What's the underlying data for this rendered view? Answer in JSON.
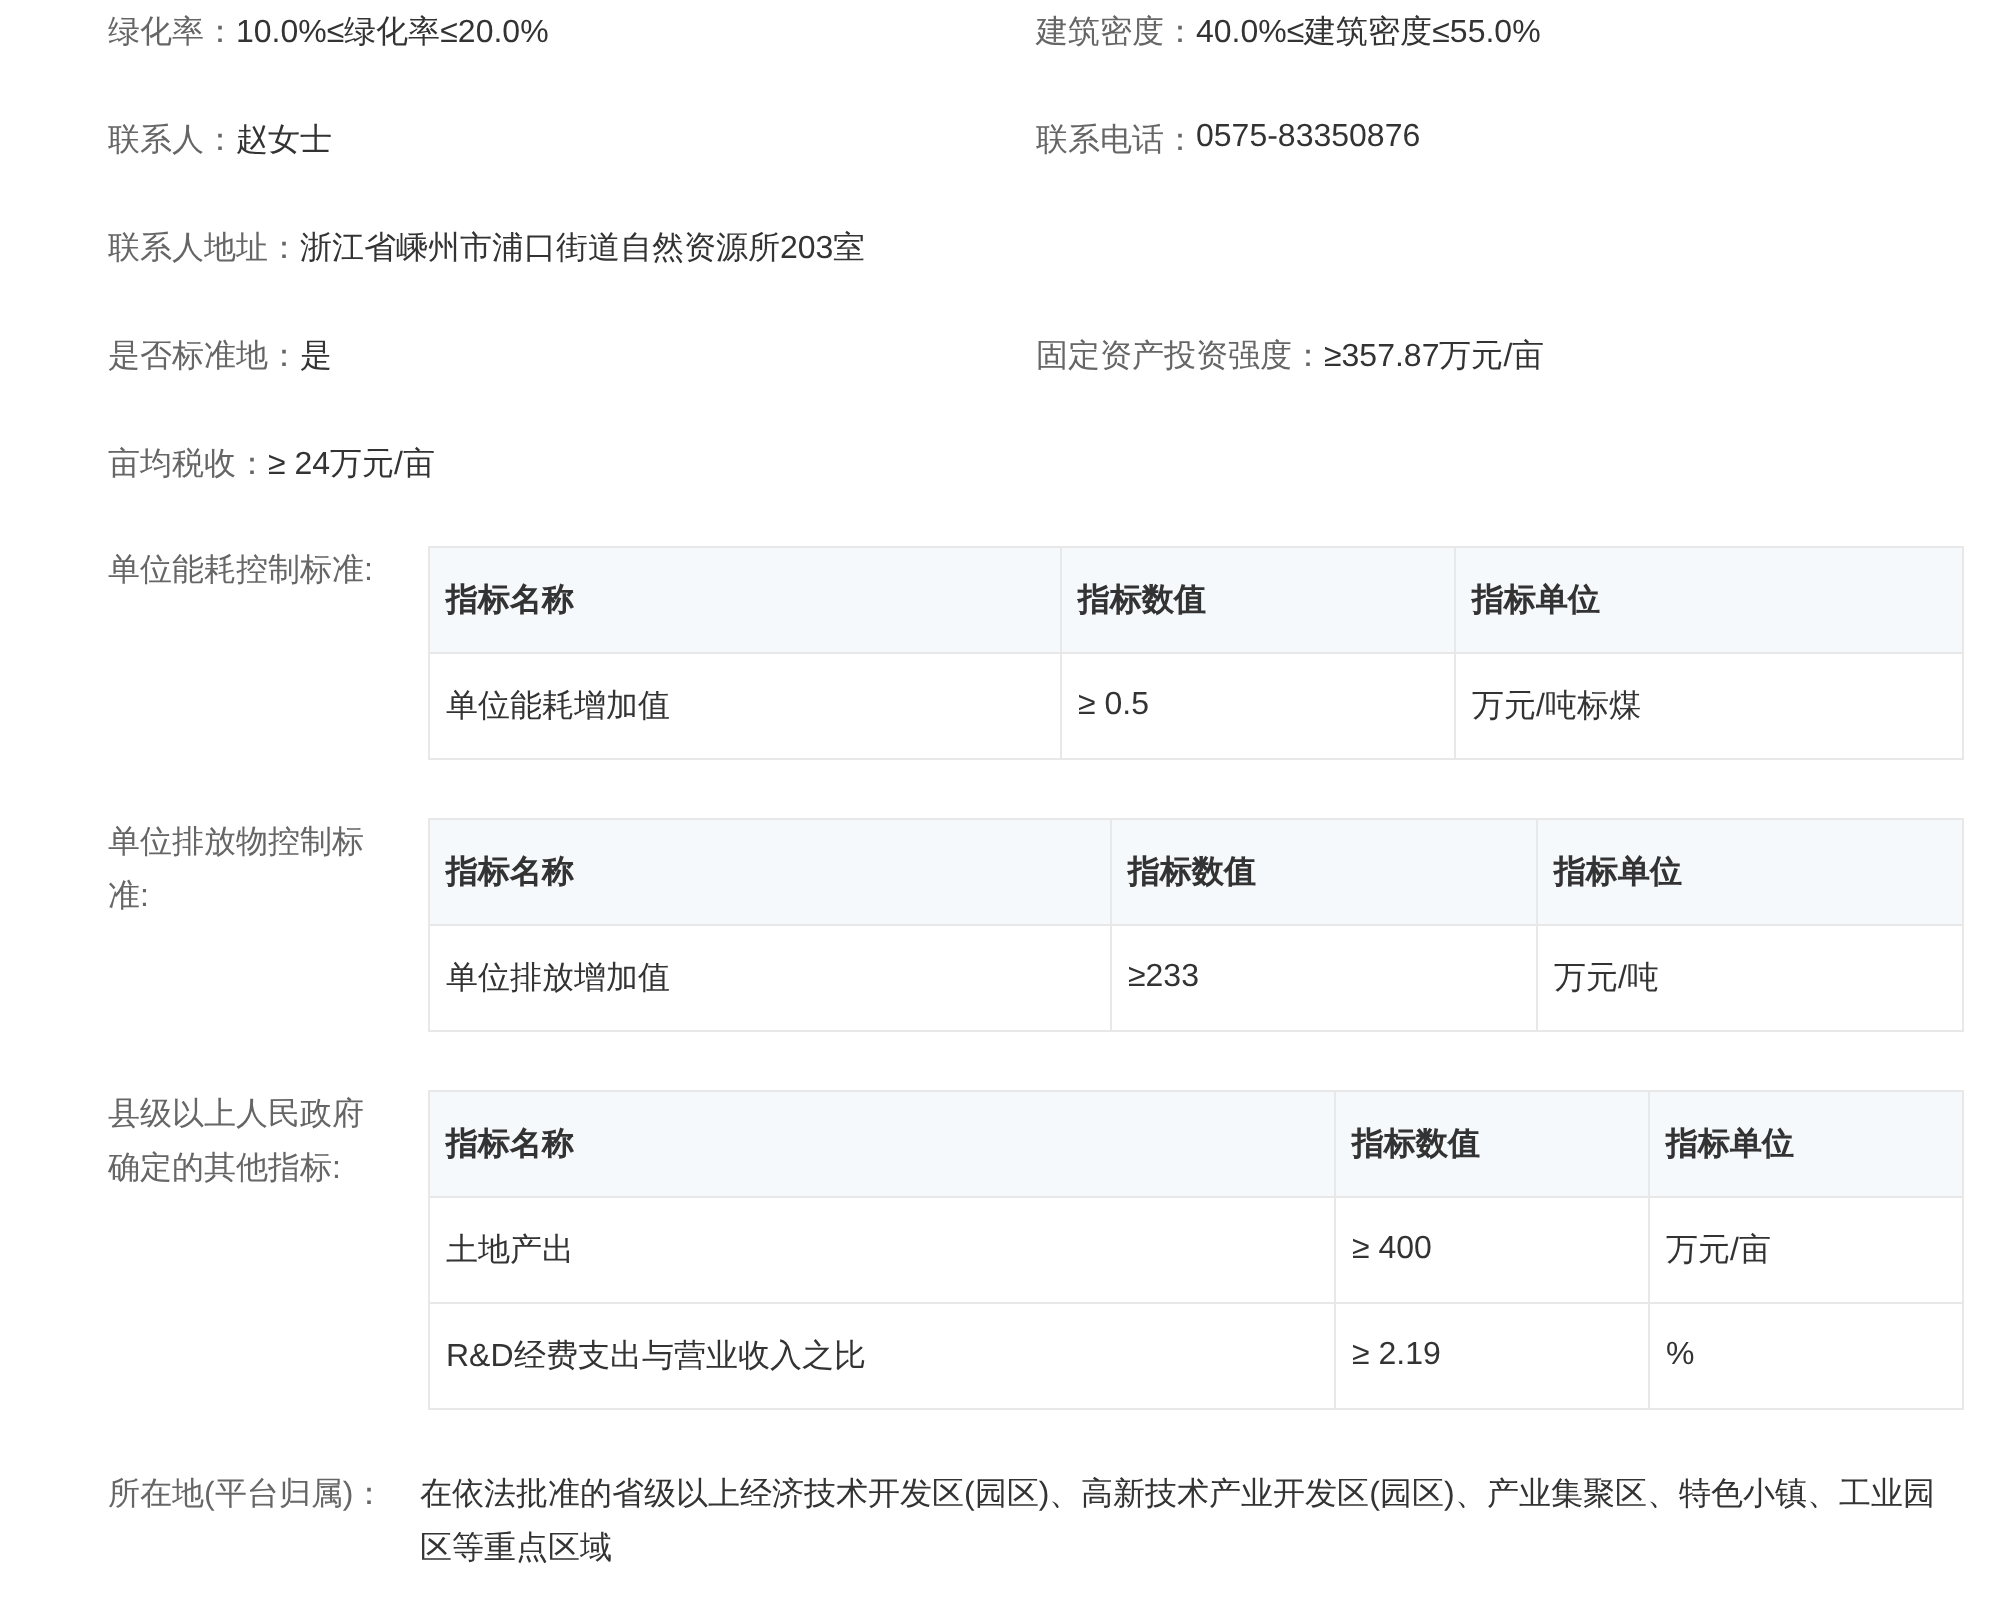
{
  "fields": [
    {
      "items": [
        {
          "label": "绿化率：",
          "value": "10.0%≤绿化率≤20.0%"
        },
        {
          "label": "建筑密度：",
          "value": "40.0%≤建筑密度≤55.0%"
        }
      ]
    },
    {
      "items": [
        {
          "label": "联系人：",
          "value": "赵女士"
        },
        {
          "label": "联系电话：",
          "value": "0575-83350876"
        }
      ]
    },
    {
      "items": [
        {
          "label": "联系人地址：",
          "value": "浙江省嵊州市浦口街道自然资源所203室"
        }
      ]
    },
    {
      "items": [
        {
          "label": "是否标准地：",
          "value": "是"
        },
        {
          "label": "固定资产投资强度：",
          "value": "≥357.87万元/亩"
        }
      ]
    },
    {
      "items": [
        {
          "label": "亩均税收：",
          "value": "≥ 24万元/亩"
        }
      ]
    }
  ],
  "standards": [
    {
      "label": "单位能耗控制标准:",
      "columns": [
        "指标名称",
        "指标数值",
        "指标单位"
      ],
      "rows": [
        [
          "单位能耗增加值",
          "≥ 0.5",
          "万元/吨标煤"
        ]
      ]
    },
    {
      "label": "单位排放物控制标准:",
      "columns": [
        "指标名称",
        "指标数值",
        "指标单位"
      ],
      "rows": [
        [
          "单位排放增加值",
          "≥233",
          "万元/吨"
        ]
      ]
    },
    {
      "label": "县级以上人民政府确定的其他指标:",
      "columns": [
        "指标名称",
        "指标数值",
        "指标单位"
      ],
      "rows": [
        [
          "土地产出",
          "≥ 400",
          "万元/亩"
        ],
        [
          "R&D经费支出与营业收入之比",
          "≥ 2.19",
          "%"
        ]
      ]
    }
  ],
  "location": {
    "label": "所在地(平台归属)：",
    "value": "在依法批准的省级以上经济技术开发区(园区)、高新技术产业开发区(园区)、产业集聚区、特色小镇、工业园区等重点区域"
  }
}
